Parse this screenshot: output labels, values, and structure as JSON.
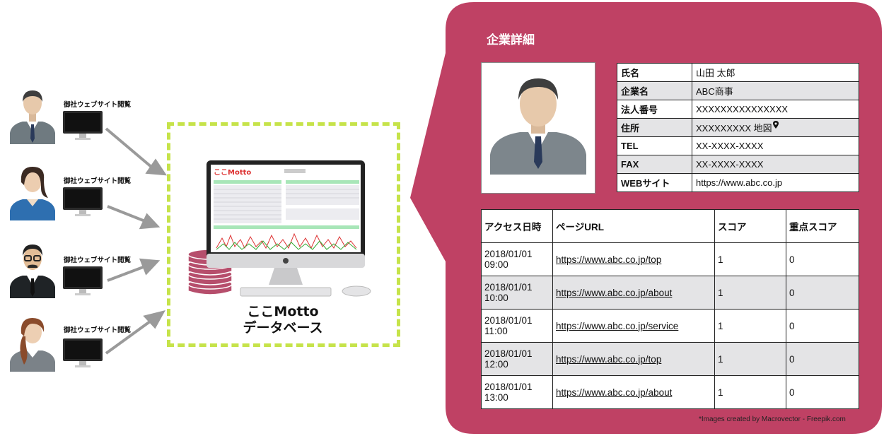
{
  "visitors": {
    "caption": "御社ウェブサイト閲覧",
    "items": [
      {
        "role": "man-in-suit"
      },
      {
        "role": "woman-in-blue"
      },
      {
        "role": "man-with-glasses"
      },
      {
        "role": "woman-with-braid"
      }
    ]
  },
  "database": {
    "app_logo": "ここMotto",
    "label_line1": "ここMotto",
    "label_line2": "データベース"
  },
  "detail": {
    "title": "企業詳細",
    "info": [
      {
        "key": "氏名",
        "value": "山田 太郎"
      },
      {
        "key": "企業名",
        "value": "ABC商事"
      },
      {
        "key": "法人番号",
        "value": "XXXXXXXXXXXXXXX"
      },
      {
        "key": "住所",
        "value": "XXXXXXXXX 地図"
      },
      {
        "key": "TEL",
        "value": "XX-XXXX-XXXX"
      },
      {
        "key": "FAX",
        "value": "XX-XXXX-XXXX"
      },
      {
        "key": "WEBサイト",
        "value": "https://www.abc.co.jp"
      }
    ],
    "access": {
      "headers": [
        "アクセス日時",
        "ページURL",
        "スコア",
        "重点スコア"
      ],
      "rows": [
        {
          "date": "2018/01/01",
          "time": "09:00",
          "url": "https://www.abc.co.jp/top",
          "score": "1",
          "key_score": "0"
        },
        {
          "date": "2018/01/01",
          "time": "10:00",
          "url": "https://www.abc.co.jp/about",
          "score": "1",
          "key_score": "0"
        },
        {
          "date": "2018/01/01",
          "time": "11:00",
          "url": "https://www.abc.co.jp/service",
          "score": "1",
          "key_score": "0"
        },
        {
          "date": "2018/01/01",
          "time": "12:00",
          "url": "https://www.abc.co.jp/top",
          "score": "1",
          "key_score": "0"
        },
        {
          "date": "2018/01/01",
          "time": "13:00",
          "url": "https://www.abc.co.jp/about",
          "score": "1",
          "key_score": "0"
        }
      ]
    }
  },
  "credit": "*Images created by Macrovector - Freepik.com",
  "colors": {
    "panel": "#bf4164",
    "dashed": "#c6e34a",
    "arrow": "#9a9a9a",
    "stack": "#b64e6c"
  }
}
